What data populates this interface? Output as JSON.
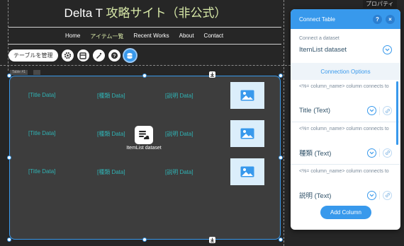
{
  "site": {
    "title_part1": "Delta T ",
    "title_part2": "攻略サイト（非公式）"
  },
  "nav": [
    "Home",
    "アイテム一覧",
    "Recent Works",
    "About",
    "Contact"
  ],
  "nav_active_index": 1,
  "toolbar": {
    "manage_table_label": "テーブルを管理"
  },
  "properties_label": "プロパティ",
  "repeater": {
    "tag_label": "Table #1",
    "rows": [
      {
        "title": "[Title Data]",
        "type": "[種類 Data]",
        "desc": "[説明 Data]"
      },
      {
        "title": "[Title Data]",
        "type": "[種類 Data]",
        "desc": "[説明 Data]"
      },
      {
        "title": "[Title Data]",
        "type": "[種類 Data]",
        "desc": "[説明 Data]"
      }
    ],
    "dataset_label": "ItemList dataset"
  },
  "panel": {
    "title": "Connect Table",
    "help_icon": "?",
    "close_icon": "×",
    "dataset_prompt": "Connect a dataset",
    "dataset_value": "ItemList dataset",
    "options_heading": "Connection Options",
    "column_prompt": "<%= column_name> column connects to",
    "columns": [
      {
        "value": "Title (Text)"
      },
      {
        "value": "種類 (Text)"
      },
      {
        "value": "説明 (Text)"
      }
    ],
    "add_button": "Add Column"
  },
  "colors": {
    "accent": "#3899ec",
    "cell_text": "#2fb3b5",
    "nav_active": "#d8e9a8",
    "background": "#262626",
    "repeater_bg": "#3d3d3d"
  }
}
